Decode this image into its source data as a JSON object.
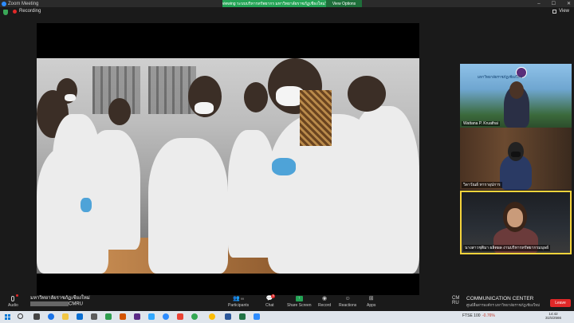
{
  "window": {
    "title": "Zoom Meeting",
    "viewing_banner": "You are viewing ระบบบริหารทรัพยากร มหาวิทยาลัยราชภัฏเชียงใหม่'s screen",
    "view_options_label": "View Options",
    "controls": [
      "–",
      "☐",
      "✕"
    ]
  },
  "topbar": {
    "recording_label": "Recording",
    "view_label": "View"
  },
  "participants": [
    {
      "name": "Wattana P. Kruathai",
      "banner_text": "มหาวิทยาลัยราชภัฏเชียงใหม่"
    },
    {
      "name": "วิลาวัณย์ ทาราอุปการ"
    },
    {
      "name": "นางสาวชุติมา ผลิตผล งานบริหารทรัพยากรมนุษย์"
    }
  ],
  "footer": {
    "host_name": "มหาวิทยาลัยราชภัฏเชียงใหม่",
    "host_sub": "CMRU"
  },
  "toolbar": {
    "audio": "Audio",
    "participants": "Participants",
    "participants_count": "99",
    "chat": "Chat",
    "chat_badge": "9",
    "share_screen": "Share Screen",
    "record": "Record",
    "reactions": "Reactions",
    "apps": "Apps",
    "leave": "Leave"
  },
  "brand": {
    "logo_top": "CM",
    "logo_bottom": "RU",
    "title": "COMMUNICATION CENTER",
    "subtitle": "ศูนย์สื่อสารองค์กร มหาวิทยาลัยราชภัฏเชียงใหม่"
  },
  "taskbar": {
    "stock": "FTSE 100",
    "stock_change": "-0.76%",
    "time": "14:42",
    "date": "31/5/2566"
  },
  "colors": {
    "accent_green": "#23a455",
    "leave_red": "#e02828",
    "active_speaker": "#f5d33b"
  }
}
